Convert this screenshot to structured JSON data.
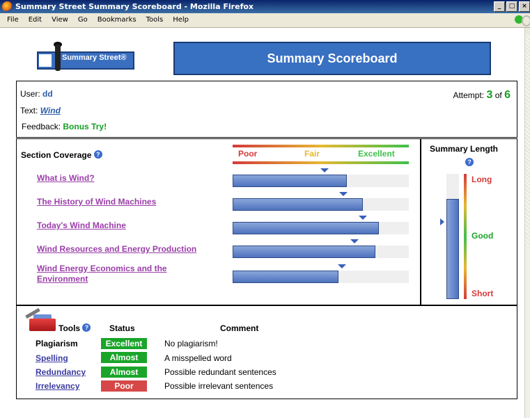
{
  "window": {
    "title": "Summary Street Summary Scoreboard - Mozilla Firefox",
    "buttons": [
      "_",
      "□",
      "×"
    ]
  },
  "menu": [
    "File",
    "Edit",
    "View",
    "Go",
    "Bookmarks",
    "Tools",
    "Help"
  ],
  "logo": {
    "text": "Summary Street®"
  },
  "banner": {
    "title": "Summary Scoreboard"
  },
  "user": {
    "user_label": "User:",
    "user_value": "dd",
    "text_label": "Text:",
    "text_value": "Wind",
    "feedback_label": "Feedback:",
    "feedback_value": "Bonus Try!",
    "attempt_label": "Attempt:",
    "attempt_current": "3",
    "attempt_of": "of",
    "attempt_total": "6"
  },
  "coverage": {
    "title": "Section Coverage",
    "scale_labels": [
      "Poor",
      "Fair",
      "Excellent"
    ],
    "sections": [
      {
        "label": "What is Wind?",
        "fill": 0.65,
        "marker": 0.52
      },
      {
        "label": "The History of Wind Machines",
        "fill": 0.74,
        "marker": 0.63
      },
      {
        "label": "Today's Wind Machine",
        "fill": 0.83,
        "marker": 0.74
      },
      {
        "label": "Wind Resources and Energy Production",
        "fill": 0.81,
        "marker": 0.69
      },
      {
        "label": "Wind Energy Economics and the Environment",
        "fill": 0.6,
        "marker": 0.62
      }
    ]
  },
  "length": {
    "title": "Summary Length",
    "labels": {
      "long": "Long",
      "good": "Good",
      "short": "Short"
    },
    "level": 0.8
  },
  "tools": {
    "title": "Tools",
    "status_header": "Status",
    "comment_header": "Comment",
    "rows": [
      {
        "name": "Plagiarism",
        "status": "Excellent",
        "comment": "No plagiarism!",
        "color": "#1aa52a",
        "link": false
      },
      {
        "name": "Spelling",
        "status": "Almost",
        "comment": "A misspelled word",
        "color": "#1aa52a",
        "link": true
      },
      {
        "name": "Redundancy",
        "status": "Almost",
        "comment": "Possible redundant sentences",
        "color": "#1aa52a",
        "link": true
      },
      {
        "name": "Irrelevancy",
        "status": "Poor",
        "comment": "Possible irrelevant sentences",
        "color": "#d64848",
        "link": true
      }
    ]
  },
  "colors": {
    "poor": "#d43a3a",
    "fair": "#e6b832",
    "excellent": "#3ec04a",
    "banner": "#3870c2"
  }
}
